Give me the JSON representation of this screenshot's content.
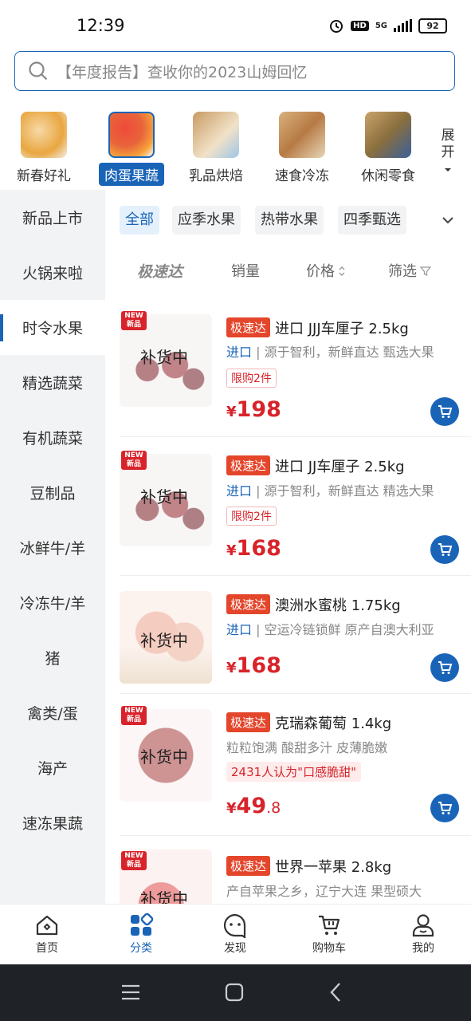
{
  "status": {
    "time": "12:39",
    "network": "5G",
    "battery": "92"
  },
  "search": {
    "placeholder": "【年度报告】查收你的2023山姆回忆"
  },
  "categories": [
    {
      "label": "新春好礼",
      "color": "#e9a640"
    },
    {
      "label": "肉蛋果蔬",
      "color": "#e8643a"
    },
    {
      "label": "乳品烘焙",
      "color": "#c99a62"
    },
    {
      "label": "速食冷冻",
      "color": "#b77a44"
    },
    {
      "label": "休闲零食",
      "color": "#8a6f3e"
    }
  ],
  "expand_label": [
    "展",
    "开"
  ],
  "sidebar": [
    "新品上市",
    "火锅来啦",
    "时令水果",
    "精选蔬菜",
    "有机蔬菜",
    "豆制品",
    "冰鲜牛/羊",
    "冷冻牛/羊",
    "猪",
    "禽类/蛋",
    "海产",
    "速冻果蔬"
  ],
  "filters": [
    "全部",
    "应季水果",
    "热带水果",
    "四季甄选"
  ],
  "sort": {
    "fast": "极速达",
    "sales": "销量",
    "price": "价格",
    "filter": "筛选"
  },
  "products": [
    {
      "new": "NEW 新品",
      "restock": "补货中",
      "tag": "极速达",
      "name": "进口 JJJ车厘子 2.5kg",
      "desc_highlight": "进口",
      "desc": "源于智利，新鲜直达 甄选大果",
      "limit": "限购2件",
      "currency": "¥",
      "price_int": "198",
      "price_dec": ""
    },
    {
      "new": "NEW 新品",
      "restock": "补货中",
      "tag": "极速达",
      "name": "进口 JJ车厘子 2.5kg",
      "desc_highlight": "进口",
      "desc": "源于智利，新鲜直达 精选大果",
      "limit": "限购2件",
      "currency": "¥",
      "price_int": "168",
      "price_dec": ""
    },
    {
      "new": "",
      "restock": "补货中",
      "tag": "极速达",
      "name": "澳洲水蜜桃 1.75kg",
      "desc_highlight": "进口",
      "desc": "空运冷链锁鲜 原产自澳大利亚",
      "limit": "",
      "currency": "¥",
      "price_int": "168",
      "price_dec": ""
    },
    {
      "new": "NEW 新品",
      "restock": "补货中",
      "tag": "极速达",
      "name": "克瑞森葡萄 1.4kg",
      "desc_highlight": "",
      "desc": "粒粒饱满 酸甜多汁 皮薄脆嫩",
      "praise": "2431人认为\"口感脆甜\"",
      "currency": "¥",
      "price_int": "49",
      "price_dec": ".8"
    },
    {
      "new": "NEW 新品",
      "restock": "补货中",
      "tag": "极速达",
      "name": "世界一苹果 2.8kg",
      "desc_highlight": "",
      "desc": "产自苹果之乡，辽宁大连 果型硕大"
    }
  ],
  "bottom_nav": [
    "首页",
    "分类",
    "发现",
    "购物车",
    "我的"
  ],
  "colors": {
    "primary": "#1a64b8",
    "price": "#d8232a",
    "tag": "#e4462b"
  }
}
